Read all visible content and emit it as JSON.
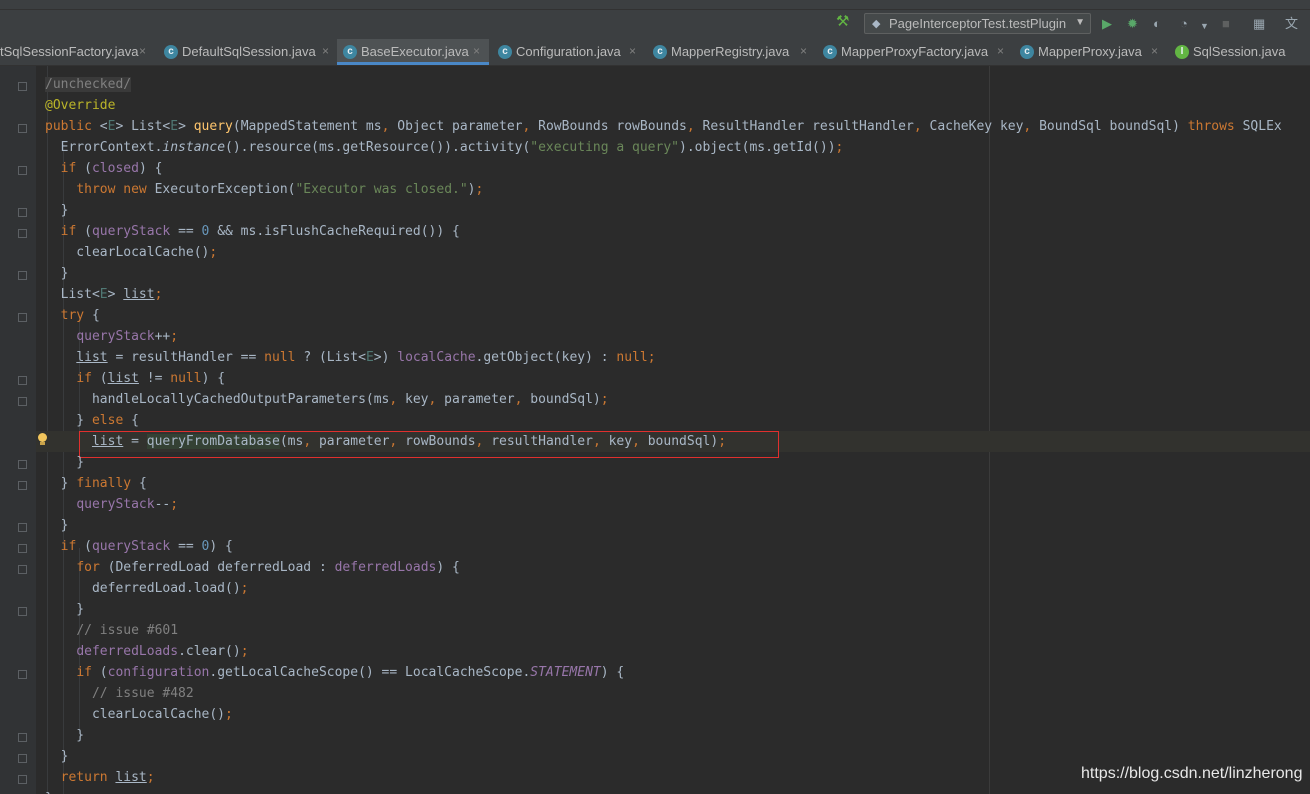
{
  "toolbar": {
    "run_config": "PageInterceptorTest.testPlugin"
  },
  "tabs": [
    {
      "label": "tSqlSessionFactory.java",
      "icon": "class-icon"
    },
    {
      "label": "DefaultSqlSession.java",
      "icon": "class-icon"
    },
    {
      "label": "BaseExecutor.java",
      "icon": "class-icon",
      "active": true
    },
    {
      "label": "Configuration.java",
      "icon": "class-icon"
    },
    {
      "label": "MapperRegistry.java",
      "icon": "class-icon"
    },
    {
      "label": "MapperProxyFactory.java",
      "icon": "class-icon"
    },
    {
      "label": "MapperProxy.java",
      "icon": "class-icon"
    },
    {
      "label": "SqlSession.java",
      "icon": "interface-icon"
    }
  ],
  "code": {
    "language": "java",
    "highlighted_line": "list = queryFromDatabase(ms, parameter, rowBounds, resultHandler, key, boundSql);",
    "lines": [
      "/unchecked/",
      "@Override",
      "public <E> List<E> query(MappedStatement ms, Object parameter, RowBounds rowBounds, ResultHandler resultHandler, CacheKey key, BoundSql boundSql) throws SQLEx",
      "ErrorContext.instance().resource(ms.getResource()).activity(\"executing a query\").object(ms.getId());",
      "if (closed) {",
      "throw new ExecutorException(\"Executor was closed.\");",
      "}",
      "if (queryStack == 0 && ms.isFlushCacheRequired()) {",
      "clearLocalCache();",
      "}",
      "List<E> list;",
      "try {",
      "queryStack++;",
      "list = resultHandler == null ? (List<E>) localCache.getObject(key) : null;",
      "if (list != null) {",
      "handleLocallyCachedOutputParameters(ms, key, parameter, boundSql);",
      "} else {",
      "list = queryFromDatabase(ms, parameter, rowBounds, resultHandler, key, boundSql);",
      "}",
      "} finally {",
      "queryStack--;",
      "}",
      "if (queryStack == 0) {",
      "for (DeferredLoad deferredLoad : deferredLoads) {",
      "deferredLoad.load();",
      "}",
      "// issue #601",
      "deferredLoads.clear();",
      "if (configuration.getLocalCacheScope() == LocalCacheScope.STATEMENT) {",
      "// issue #482",
      "clearLocalCache();",
      "}",
      "}",
      "return list;"
    ]
  },
  "watermark": "https://blog.csdn.net/linzherong",
  "colors": {
    "editor_bg": "#2b2b2b",
    "keyword": "#cc7832",
    "string": "#6a8759",
    "field": "#9876aa",
    "method_decl": "#ffc66d",
    "annotation": "#bbb529",
    "number": "#6897bb",
    "comment": "#808080",
    "highlight_box": "#e0302e"
  }
}
